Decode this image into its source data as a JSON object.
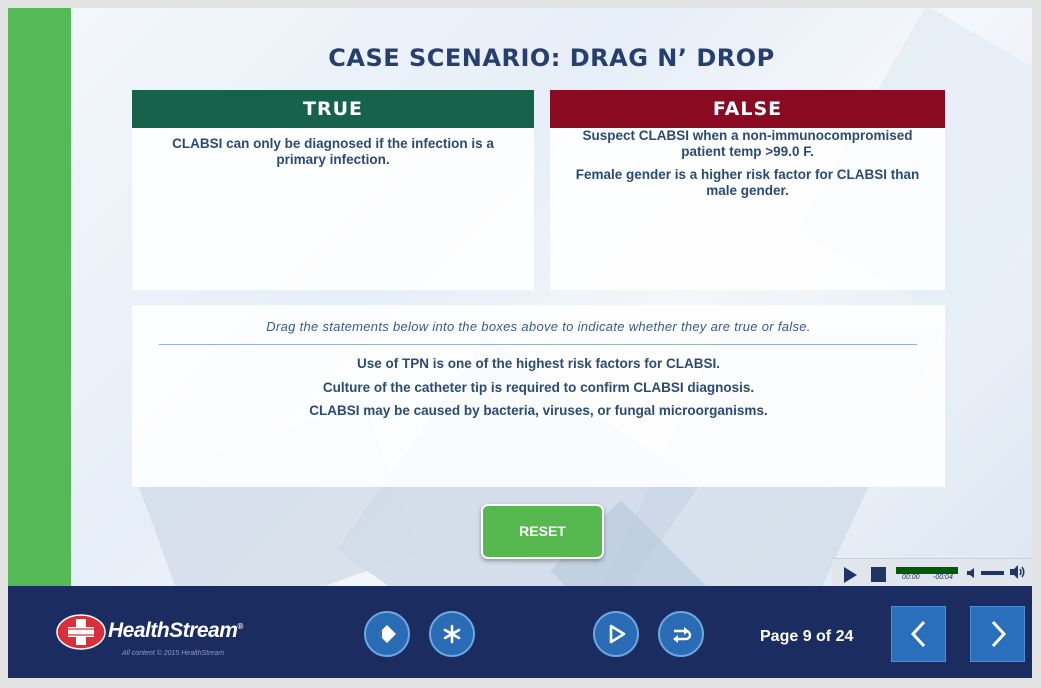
{
  "slide": {
    "title": "CASE SCENARIO: DRAG N’ DROP",
    "true_box": {
      "heading": "TRUE",
      "statements": [
        "CLABSI can only be diagnosed if the infection is a primary infection."
      ]
    },
    "false_box": {
      "heading": "FALSE",
      "statements": [
        "Suspect CLABSI when a non-immunocompromised patient temp >99.0 F.",
        "Female gender is a higher risk factor for CLABSI than male gender."
      ]
    },
    "drag_area": {
      "instruction": "Drag the statements below into the boxes above to indicate whether they are true or false.",
      "items": [
        "Use of TPN is one of the highest risk factors for CLABSI.",
        "Culture of the catheter tip is required to confirm CLABSI diagnosis.",
        "CLABSI may be caused by bacteria, viruses, or fungal microorganisms."
      ]
    },
    "reset_label": "RESET"
  },
  "media": {
    "elapsed": "00:00",
    "remaining": "-00:04",
    "icons": [
      "play-icon",
      "stop-icon",
      "mute-icon",
      "speaker-icon"
    ]
  },
  "footer": {
    "brand": "HealthStream",
    "brand_mark": "®",
    "copyright": "All content © 2015 HealthStream",
    "page_indicator": "Page 9 of 24",
    "icons": [
      "glossary-icon",
      "resources-icon",
      "play-icon",
      "replay-icon",
      "chevron-left-icon",
      "chevron-right-icon"
    ]
  },
  "colors": {
    "left_bar": "#55b955",
    "title": "#263f71",
    "true_header": "#16624a",
    "false_header": "#8a0a22",
    "reset": "#56b84f",
    "footer": "#1b2c61",
    "button_blue": "#2a6bb5"
  }
}
